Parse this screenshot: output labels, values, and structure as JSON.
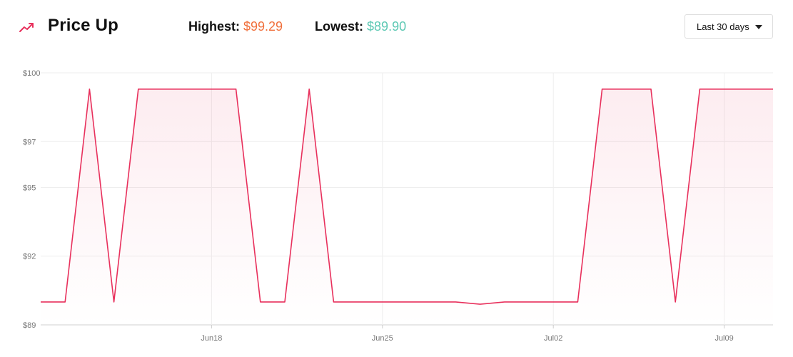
{
  "header": {
    "title": "Price Up",
    "highest_label": "Highest:",
    "highest_value": "$99.29",
    "lowest_label": "Lowest:",
    "lowest_value": "$89.90",
    "range_select": "Last 30 days",
    "icon": "trending-up-icon",
    "accent_color": "#e8305c",
    "highest_color": "#f0703c",
    "lowest_color": "#5cc8b3"
  },
  "chart_data": {
    "type": "line",
    "title": "",
    "xlabel": "",
    "ylabel": "",
    "ylim": [
      89,
      100
    ],
    "yticks": [
      89,
      92,
      95,
      97,
      100
    ],
    "ytick_labels": [
      "$89",
      "$92",
      "$95",
      "$97",
      "$100"
    ],
    "xticks": [
      "2024-06-18",
      "2024-06-25",
      "2024-07-02",
      "2024-07-09"
    ],
    "xtick_labels": [
      "Jun18",
      "Jun25",
      "Jul02",
      "Jul09"
    ],
    "xlim": [
      "2024-06-11",
      "2024-07-11"
    ],
    "grid": true,
    "series": [
      {
        "color": "#e8305c",
        "fill": true,
        "points": [
          [
            "2024-06-11",
            90.0
          ],
          [
            "2024-06-12",
            90.0
          ],
          [
            "2024-06-13",
            99.29
          ],
          [
            "2024-06-14",
            90.0
          ],
          [
            "2024-06-15",
            99.29
          ],
          [
            "2024-06-16",
            99.29
          ],
          [
            "2024-06-17",
            99.29
          ],
          [
            "2024-06-18",
            99.29
          ],
          [
            "2024-06-19",
            99.29
          ],
          [
            "2024-06-20",
            90.0
          ],
          [
            "2024-06-21",
            90.0
          ],
          [
            "2024-06-22",
            99.29
          ],
          [
            "2024-06-23",
            90.0
          ],
          [
            "2024-06-24",
            90.0
          ],
          [
            "2024-06-25",
            90.0
          ],
          [
            "2024-06-26",
            90.0
          ],
          [
            "2024-06-27",
            90.0
          ],
          [
            "2024-06-28",
            90.0
          ],
          [
            "2024-06-29",
            89.9
          ],
          [
            "2024-06-30",
            90.0
          ],
          [
            "2024-07-01",
            90.0
          ],
          [
            "2024-07-02",
            90.0
          ],
          [
            "2024-07-03",
            90.0
          ],
          [
            "2024-07-04",
            99.29
          ],
          [
            "2024-07-05",
            99.29
          ],
          [
            "2024-07-06",
            99.29
          ],
          [
            "2024-07-07",
            90.0
          ],
          [
            "2024-07-08",
            99.29
          ],
          [
            "2024-07-09",
            99.29
          ],
          [
            "2024-07-10",
            99.29
          ],
          [
            "2024-07-11",
            99.29
          ]
        ]
      }
    ]
  }
}
